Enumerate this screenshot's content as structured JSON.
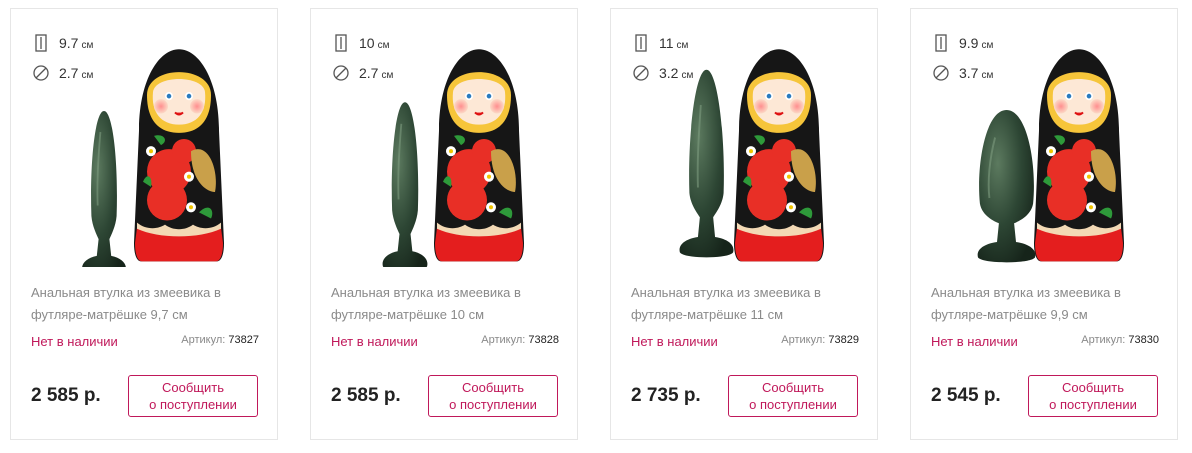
{
  "products": [
    {
      "length": "9.7",
      "diameter": "2.7",
      "unit": "см",
      "title": "Анальная втулка из змеевика в футляре-матрёшке 9,7 см",
      "stock": "Нет в наличии",
      "sku_label": "Артикул:",
      "sku": "73827",
      "price": "2 585 р.",
      "button_line1": "Сообщить",
      "button_line2": "о поступлении"
    },
    {
      "length": "10",
      "diameter": "2.7",
      "unit": "см",
      "title": "Анальная втулка из змеевика в футляре-матрёшке 10 см",
      "stock": "Нет в наличии",
      "sku_label": "Артикул:",
      "sku": "73828",
      "price": "2 585 р.",
      "button_line1": "Сообщить",
      "button_line2": "о поступлении"
    },
    {
      "length": "11",
      "diameter": "3.2",
      "unit": "см",
      "title": "Анальная втулка из змеевика в футляре-матрёшке 11 см",
      "stock": "Нет в наличии",
      "sku_label": "Артикул:",
      "sku": "73829",
      "price": "2 735 р.",
      "button_line1": "Сообщить",
      "button_line2": "о поступлении"
    },
    {
      "length": "9.9",
      "diameter": "3.7",
      "unit": "см",
      "title": "Анальная втулка из змеевика в футляре-матрёшке 9,9 см",
      "stock": "Нет в наличии",
      "sku_label": "Артикул:",
      "sku": "73830",
      "price": "2 545 р.",
      "button_line1": "Сообщить",
      "button_line2": "о поступлении"
    }
  ],
  "colors": {
    "accent": "#c0185a",
    "stone": "#2f4a35",
    "border": "#e6e6e6"
  },
  "icons": {
    "length": "length-icon",
    "diameter": "diameter-icon"
  }
}
